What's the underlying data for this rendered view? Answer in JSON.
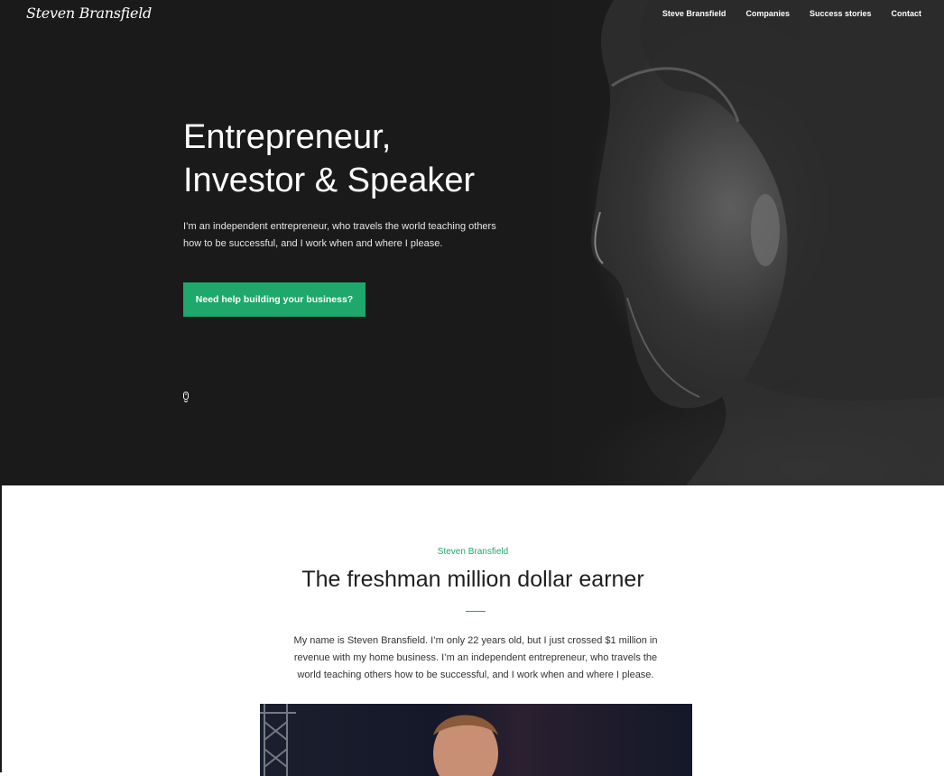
{
  "brand": {
    "logo_text": "Steven Bransfield"
  },
  "nav": {
    "items": [
      {
        "label": "Steve Bransfield"
      },
      {
        "label": "Companies"
      },
      {
        "label": "Success stories"
      },
      {
        "label": "Contact"
      }
    ]
  },
  "hero": {
    "title_line1": "Entrepreneur,",
    "title_line2": "Investor & Speaker",
    "text": "I’m an independent entrepreneur, who travels the world teaching others how to be successful, and I work when and where I please.",
    "cta_label": "Need help building your business?",
    "scroll_icon": "mouse-scroll-icon"
  },
  "about": {
    "eyebrow": "Steven Bransfield",
    "title": "The freshman million dollar earner",
    "text": "My name is Steven Bransfield. I’m only 22 years old, but I just crossed $1 million in revenue with my home business. I’m an independent entrepreneur, who travels the world teaching others how to be successful, and I work when and where I please."
  },
  "colors": {
    "accent": "#1ea86b",
    "hero_bg": "#1a1a1a",
    "text_dark": "#1f1f1f"
  }
}
